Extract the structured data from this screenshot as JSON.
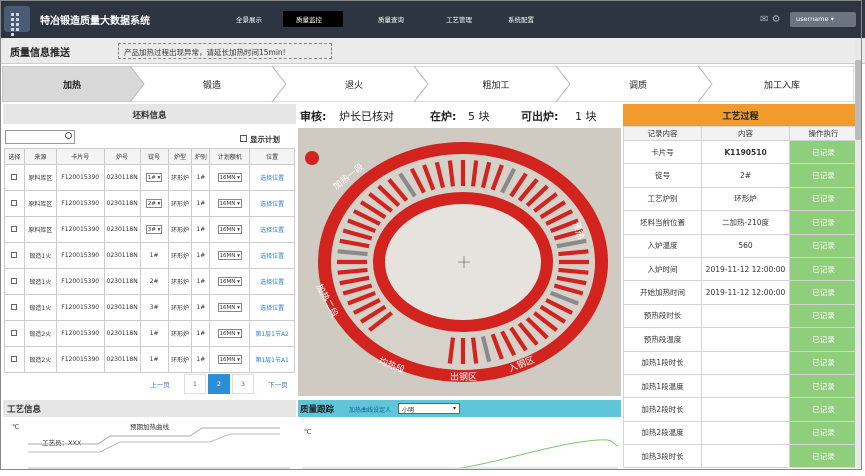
{
  "app": {
    "title": "特冶锻造质量大数据系统"
  },
  "nav": {
    "items": [
      "全景展示",
      "质量监控",
      "质量查询",
      "工艺管理",
      "系统配置"
    ],
    "active": "质量监控",
    "user": "username"
  },
  "notice": {
    "title": "质量信息推送",
    "message": "产品加热过程出现异常，请延长加热时间15min!"
  },
  "steps": [
    "加热",
    "锻造",
    "退火",
    "粗加工",
    "调质",
    "加工入库"
  ],
  "blank": {
    "title": "坯料信息",
    "show_plan": "显示计划",
    "columns": [
      "选择",
      "来源",
      "卡片号",
      "炉号",
      "锭号",
      "炉型",
      "炉别",
      "计划额机",
      "位置"
    ],
    "rows": [
      {
        "src": "原料库区",
        "card": "F120015390",
        "furnace": "0230118N",
        "ingot": "1#",
        "type": "环形炉",
        "cls": "1#",
        "plan": "16MN",
        "pos": "选择位置"
      },
      {
        "src": "原料库区",
        "card": "F120015390",
        "furnace": "0230118N",
        "ingot": "2#",
        "type": "环形炉",
        "cls": "1#",
        "plan": "16MN",
        "pos": "选择位置"
      },
      {
        "src": "原料库区",
        "card": "F120015390",
        "furnace": "0230118N",
        "ingot": "3#",
        "type": "环形炉",
        "cls": "1#",
        "plan": "16MN",
        "pos": "选择位置"
      },
      {
        "src": "锻造1火",
        "card": "F120015390",
        "furnace": "0230118N",
        "ingot": "1#",
        "type": "环形炉",
        "cls": "1#",
        "plan": "16MN",
        "pos": "选择位置"
      },
      {
        "src": "锻造1火",
        "card": "F120015390",
        "furnace": "0230118N",
        "ingot": "2#",
        "type": "环形炉",
        "cls": "1#",
        "plan": "16MN",
        "pos": "选择位置"
      },
      {
        "src": "锻造1火",
        "card": "F120015390",
        "furnace": "0230118N",
        "ingot": "3#",
        "type": "环形炉",
        "cls": "1#",
        "plan": "16MN",
        "pos": "选择位置"
      },
      {
        "src": "锻造2火",
        "card": "F120015390",
        "furnace": "0230118N",
        "ingot": "1#",
        "type": "环形炉",
        "cls": "1#",
        "plan": "16MN",
        "pos": "第1层1节A2"
      },
      {
        "src": "锻造2火",
        "card": "F120015390",
        "furnace": "0230118N",
        "ingot": "1#",
        "type": "环形炉",
        "cls": "1#",
        "plan": "16MN",
        "pos": "第1层1节A1"
      }
    ],
    "pager": {
      "prev": "上一页",
      "pages": [
        "1",
        "2",
        "3"
      ],
      "current": "2",
      "next": "下一页"
    }
  },
  "process_info": {
    "title": "工艺信息",
    "chart_title": "预期加热曲线",
    "unit": "℃",
    "process": "工艺员：XXX"
  },
  "center": {
    "audit_label": "审核:",
    "audit_value": "炉长已核对",
    "in_label": "在炉:",
    "in_value": "5 块",
    "out_label": "可出炉:",
    "out_value": "1 块",
    "zones": {
      "heat1": "加热一段",
      "heat2": "加热二段",
      "pre": "预热",
      "soak": "均热段",
      "exit": "出钢区",
      "entry": "入钢区"
    }
  },
  "quality": {
    "title": "质量跟踪",
    "setter": "加热曲线设定人",
    "setter_value": "小明",
    "unit": "℃"
  },
  "process": {
    "title": "工艺过程",
    "columns": [
      "记录内容",
      "内容",
      "操作执行"
    ],
    "status_label": "已记录",
    "rows": [
      {
        "k": "卡片号",
        "v": "K1190510"
      },
      {
        "k": "锭号",
        "v": "2#"
      },
      {
        "k": "工艺炉别",
        "v": "环形炉"
      },
      {
        "k": "坯料当前位置",
        "v": "二加热-210度"
      },
      {
        "k": "入炉温度",
        "v": "560"
      },
      {
        "k": "入炉时间",
        "v": "2019-11-12 12:00:00"
      },
      {
        "k": "开始加热时间",
        "v": "2019-11-12 12:00:00"
      },
      {
        "k": "预热段时长",
        "v": ""
      },
      {
        "k": "预热段温度",
        "v": ""
      },
      {
        "k": "加热1段时长",
        "v": ""
      },
      {
        "k": "加热1段温度",
        "v": ""
      },
      {
        "k": "加热2段时长",
        "v": ""
      },
      {
        "k": "加热2段温度",
        "v": ""
      },
      {
        "k": "加热3段时长",
        "v": ""
      }
    ]
  }
}
